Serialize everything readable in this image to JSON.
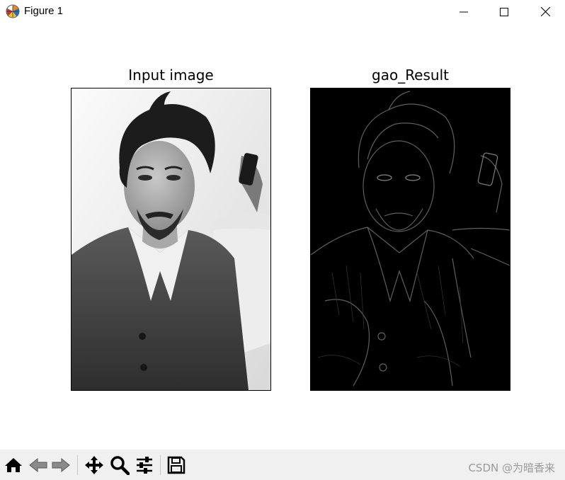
{
  "window": {
    "title": "Figure 1",
    "controls": {
      "minimize_icon": "minimize-icon",
      "maximize_icon": "maximize-icon",
      "close_icon": "close-icon"
    }
  },
  "figure": {
    "axes": [
      {
        "title": "Input image",
        "image": "grayscale portrait photograph",
        "background": "#f2f2f2"
      },
      {
        "title": "gao_Result",
        "image": "edge-detection result (dark background, bright edges)",
        "background": "#000000"
      }
    ]
  },
  "toolbar": {
    "buttons": [
      {
        "name": "home",
        "icon": "home-icon"
      },
      {
        "name": "back",
        "icon": "back-arrow-icon"
      },
      {
        "name": "forward",
        "icon": "forward-arrow-icon"
      },
      {
        "name": "pan",
        "icon": "move-icon"
      },
      {
        "name": "zoom",
        "icon": "zoom-icon"
      },
      {
        "name": "configure-subplots",
        "icon": "sliders-icon"
      },
      {
        "name": "save",
        "icon": "save-icon"
      }
    ],
    "watermark": "CSDN @为暗香来"
  }
}
